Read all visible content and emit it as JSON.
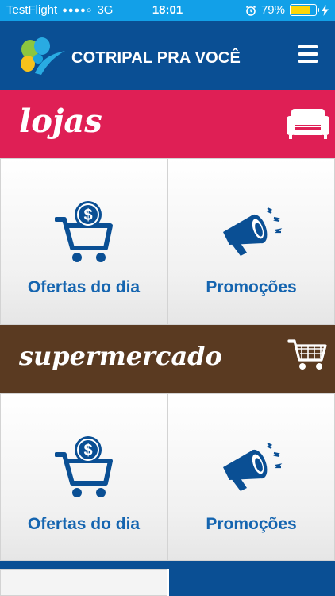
{
  "status_bar": {
    "carrier": "TestFlight",
    "signal": "●●●●○",
    "network": "3G",
    "time": "18:01",
    "battery_percent": "79%",
    "battery_level": 0.79
  },
  "header": {
    "brand": "COTRIPAL PRA VOCÊ",
    "menu_icon": "hamburger-menu-icon",
    "background": "#0a4f94"
  },
  "sections": {
    "lojas": {
      "title": "lojas",
      "icon": "sofa-icon",
      "color": "#df1f55",
      "tiles": [
        {
          "label": "Ofertas do dia",
          "icon": "cart-dollar-icon"
        },
        {
          "label": "Promoções",
          "icon": "megaphone-icon"
        }
      ]
    },
    "supermercado": {
      "title": "supermercado",
      "icon": "shopping-cart-icon",
      "color": "#5a3a21",
      "tiles": [
        {
          "label": "Ofertas do dia",
          "icon": "cart-dollar-icon"
        },
        {
          "label": "Promoções",
          "icon": "megaphone-icon"
        }
      ]
    }
  },
  "accent_text_color": "#1565b0"
}
